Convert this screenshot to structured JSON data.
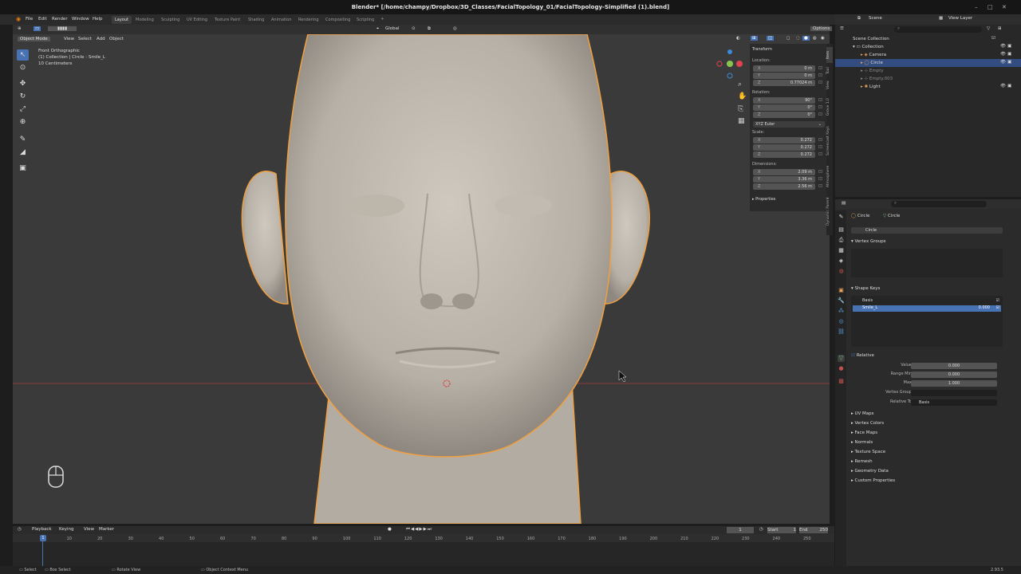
{
  "window": {
    "title": "Blender* [/home/champy/Dropbox/3D_Classes/FacialTopology_01/FacialTopology-Simplified (1).blend]"
  },
  "menu": {
    "items": [
      "File",
      "Edit",
      "Render",
      "Window",
      "Help"
    ]
  },
  "workspaces": [
    "Layout",
    "Modeling",
    "Sculpting",
    "UV Editing",
    "Texture Paint",
    "Shading",
    "Animation",
    "Rendering",
    "Compositing",
    "Scripting"
  ],
  "scene": {
    "label": "Scene",
    "view_layer": "View Layer"
  },
  "viewport": {
    "mode": "Object Mode",
    "menus": [
      "View",
      "Select",
      "Add",
      "Object"
    ],
    "transform_orientation": "Global",
    "options": "Options",
    "info_line1": "Front Orthographic",
    "info_line2": "(1) Collection | Circle : Smile_L",
    "info_line3": "10 Centimeters"
  },
  "npanel": {
    "header": "Transform",
    "location_label": "Location:",
    "location": [
      {
        "axis": "X",
        "value": "0 m"
      },
      {
        "axis": "Y",
        "value": "0 m"
      },
      {
        "axis": "Z",
        "value": "0.77024 m"
      }
    ],
    "rotation_label": "Rotation:",
    "rotation": [
      {
        "axis": "X",
        "value": "90°"
      },
      {
        "axis": "Y",
        "value": "0°"
      },
      {
        "axis": "Z",
        "value": "0°"
      }
    ],
    "rotation_mode": "XYZ Euler",
    "scale_label": "Scale:",
    "scale": [
      {
        "axis": "X",
        "value": "0.272"
      },
      {
        "axis": "Y",
        "value": "0.272"
      },
      {
        "axis": "Z",
        "value": "0.272"
      }
    ],
    "dimensions_label": "Dimensions:",
    "dimensions": [
      {
        "axis": "X",
        "value": "2.09 m"
      },
      {
        "axis": "Y",
        "value": "3.36 m"
      },
      {
        "axis": "Z",
        "value": "2.56 m"
      }
    ],
    "properties": "Properties",
    "tabs": [
      "Item",
      "Tool",
      "View",
      "Grove 1.0",
      "Screencast Keys",
      "Atmosphere",
      "Dynamic Parent"
    ]
  },
  "outliner": {
    "root": "Scene Collection",
    "items": [
      {
        "name": "Collection",
        "sel": false
      },
      {
        "name": "Camera",
        "sel": false
      },
      {
        "name": "Circle",
        "sel": true
      },
      {
        "name": "Empty",
        "sel": false
      },
      {
        "name": "Empty.003",
        "sel": false
      },
      {
        "name": "Light",
        "sel": false
      }
    ]
  },
  "properties": {
    "object_name": "Circle",
    "data_name": "Circle",
    "mesh_name": "Circle",
    "vertex_groups": "Vertex Groups",
    "shape_keys": "Shape Keys",
    "keys": [
      {
        "name": "Basis",
        "value": ""
      },
      {
        "name": "Smile_L",
        "value": "0.000"
      }
    ],
    "relative": "Relative",
    "value_label": "Value",
    "value": "0.000",
    "range_min_label": "Range Min",
    "range_min": "0.000",
    "max_label": "Max",
    "max": "1.000",
    "vertex_group_label": "Vertex Group",
    "relative_to_label": "Relative To",
    "relative_to": "Basis",
    "sections": [
      "UV Maps",
      "Vertex Colors",
      "Face Maps",
      "Normals",
      "Texture Space",
      "Remesh",
      "Geometry Data",
      "Custom Properties"
    ]
  },
  "timeline": {
    "menus": [
      "Playback",
      "Keying",
      "View",
      "Marker"
    ],
    "current_frame": "1",
    "start_label": "Start",
    "start": "1",
    "end_label": "End",
    "end": "250",
    "ticks": [
      "1",
      "10",
      "20",
      "30",
      "40",
      "50",
      "60",
      "70",
      "80",
      "90",
      "100",
      "110",
      "120",
      "130",
      "140",
      "150",
      "160",
      "170",
      "180",
      "190",
      "200",
      "210",
      "220",
      "230",
      "240",
      "250"
    ]
  },
  "status": {
    "select": "Select",
    "box_select": "Box Select",
    "rotate_view": "Rotate View",
    "context_menu": "Object Context Menu",
    "version": "2.93.5"
  },
  "colors": {
    "accent": "#4772b3",
    "selection_outline": "#f0a040",
    "skin": "#c7c0b6",
    "background": "#3a3a3a"
  }
}
